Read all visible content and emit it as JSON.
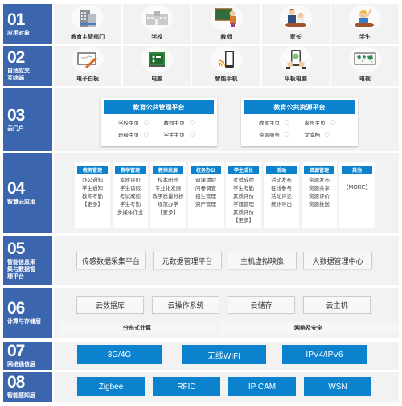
{
  "layers": {
    "l01": {
      "num": "01",
      "title": "应用对象",
      "items": [
        {
          "label": "教育主管部门",
          "icon": "government-building-icon"
        },
        {
          "label": "学校",
          "icon": "school-building-icon"
        },
        {
          "label": "教师",
          "icon": "teacher-icon"
        },
        {
          "label": "家长",
          "icon": "parent-icon"
        },
        {
          "label": "学生",
          "icon": "student-icon"
        }
      ]
    },
    "l02": {
      "num": "02",
      "title": "自适应交互终端",
      "items": [
        {
          "label": "电子白板",
          "icon": "whiteboard-icon"
        },
        {
          "label": "电脑",
          "icon": "computer-icon"
        },
        {
          "label": "智能手机",
          "icon": "smartphone-icon"
        },
        {
          "label": "平板电脑",
          "icon": "tablet-icon"
        },
        {
          "label": "电视",
          "icon": "tv-icon"
        }
      ]
    },
    "l03": {
      "num": "03",
      "title": "云门户",
      "platforms": [
        {
          "title": "教育公共管理平台",
          "items": [
            "学校主页",
            "教师主页",
            "班级主页",
            "学生主页"
          ]
        },
        {
          "title": "教育公共资源平台",
          "items": [
            "教师主页",
            "家长主页",
            "资源服务",
            "文库档"
          ]
        }
      ]
    },
    "l04": {
      "num": "04",
      "title": "智慧云应用",
      "apps": [
        {
          "title": "教务管理",
          "items": [
            "办公通知",
            "学生通知",
            "教师考勤",
            "【更多】"
          ]
        },
        {
          "title": "教学管理",
          "items": [
            "素质评价",
            "学生请假",
            "考试成绩",
            "学生考勤",
            "多媒体作业"
          ]
        },
        {
          "title": "教师发展",
          "items": [
            "校本研修",
            "专业化发展",
            "教学质量分析",
            "规范办学",
            "【更多】"
          ]
        },
        {
          "title": "校务办公",
          "items": [
            "调课请假",
            "问卷调查",
            "招生管理",
            "资产管理"
          ]
        },
        {
          "title": "学生成长",
          "items": [
            "考试成绩",
            "学生考勤",
            "素质评价",
            "学籍管理",
            "素质评价",
            "【更多】"
          ]
        },
        {
          "title": "活动",
          "items": [
            "活动发布",
            "在线参与",
            "活动评论",
            "统计导出"
          ]
        },
        {
          "title": "资源管理",
          "items": [
            "资源发布",
            "资源共享",
            "资源评价",
            "资源推送"
          ]
        },
        {
          "title": "其他",
          "items": [
            "【MORE】"
          ]
        }
      ]
    },
    "l05": {
      "num": "05",
      "title": "智能信息采集与数据管理平台",
      "title_lines": [
        "智能信息采",
        "集与数据管",
        "理平台"
      ],
      "items": [
        "传感数据采集平台",
        "元数据管理平台",
        "主机虚拟映像",
        "大数据管理中心"
      ]
    },
    "l06": {
      "num": "06",
      "title": "计算与存储层",
      "items": [
        "云数据库",
        "云操作系统",
        "云储存",
        "云主机"
      ],
      "sub_items": [
        "分布式计算",
        "网络及安全"
      ]
    },
    "l07": {
      "num": "07",
      "title": "网络通信层",
      "items": [
        "3G/4G",
        "无线WIFI",
        "IPV4/IPV6"
      ]
    },
    "l08": {
      "num": "08",
      "title": "智能感知层",
      "items": [
        "Zigbee",
        "RFID",
        "IP CAM",
        "WSN"
      ]
    }
  },
  "l02_title_lines": [
    "自适应交",
    "互终端"
  ],
  "colors": {
    "label_blue": "#3b66ae",
    "accent_blue": "#0b82cd",
    "panel_gray": "#f2f2f2"
  }
}
